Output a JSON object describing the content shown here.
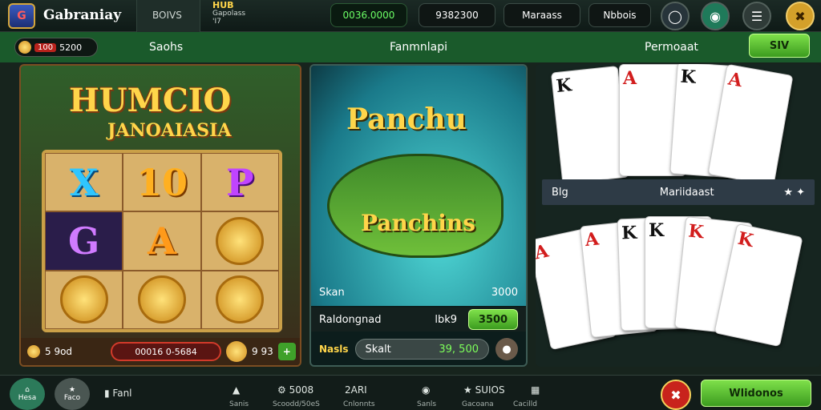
{
  "top": {
    "logo_text": "G",
    "brand": "Gabraniay",
    "tab": "BOIVS",
    "hub_title": "HUB",
    "hub_sub1": "Gapolass",
    "hub_sub2": "'I7",
    "balance": "0036.0000",
    "pill2": "9382300",
    "pill3": "Maraass",
    "pill4": "Nbbois"
  },
  "bar2": {
    "coin_amount": "5200",
    "coin_tag": "100",
    "sec1": "Saohs",
    "sec2": "Fanmnlapi",
    "sec3": "Permoaat",
    "btn": "SIV"
  },
  "slot": {
    "title": "HUMCIO",
    "subtitle": "JANOAIASIA",
    "cell_x": "X",
    "cell_10": "10",
    "cell_p": "P",
    "cell_g": "G",
    "cell_a": "A",
    "bottom_val": "5 9od",
    "red_field": "00016 0-5684",
    "side_val": "9 93",
    "plus": "+"
  },
  "fish": {
    "title": "Panchu",
    "name": "Panchins",
    "left_label": "Skan",
    "right_label": "3000",
    "row2_left": "Raldongnad",
    "row2_mid": "lbk9",
    "row2_btn": "3500",
    "row3_tag": "Nasls",
    "row3_left": "Skalt",
    "row3_val": "39, 500"
  },
  "cards": {
    "top_ranks": [
      "K",
      "A",
      "K",
      "A"
    ],
    "mid_left": "Blg",
    "mid_center": "Mariidaast",
    "bottom_ranks": [
      "A",
      "A",
      "K",
      "K",
      "K",
      "K"
    ]
  },
  "nav": {
    "home": "Hesa",
    "fav": "Faco",
    "item1": "Fanl",
    "item2_top": "5008",
    "item2_bot": "Scoodd/50eS",
    "item3_top": "2ARI",
    "item3_bot": "Cnlonnts",
    "item4": "Sanls",
    "item5_top": "SUIOS",
    "item5_bot": "Gacoana",
    "item6": "Cacilld",
    "item0_bot": "Sanis",
    "welcome": "Wlidonos"
  },
  "colors": {
    "green": "#3c9c1f",
    "gold": "#ffd54a",
    "red": "#d21d1d"
  }
}
